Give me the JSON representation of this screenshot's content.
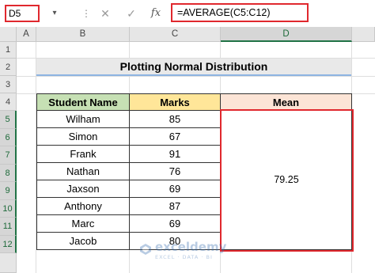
{
  "formula_bar": {
    "name_box": "D5",
    "formula": "=AVERAGE(C5:C12)",
    "cancel_icon": "✕",
    "confirm_icon": "✓",
    "fx_label": "fx"
  },
  "columns": [
    "A",
    "B",
    "C",
    "D"
  ],
  "rows": [
    "1",
    "2",
    "3",
    "4",
    "5",
    "6",
    "7",
    "8",
    "9",
    "10",
    "11",
    "12"
  ],
  "sheet": {
    "title": "Plotting Normal Distribution",
    "headers": {
      "name": "Student Name",
      "marks": "Marks",
      "mean": "Mean"
    },
    "students": [
      {
        "name": "Wilham",
        "marks": "85"
      },
      {
        "name": "Simon",
        "marks": "67"
      },
      {
        "name": "Frank",
        "marks": "91"
      },
      {
        "name": "Nathan",
        "marks": "76"
      },
      {
        "name": "Jaxson",
        "marks": "69"
      },
      {
        "name": "Anthony",
        "marks": "87"
      },
      {
        "name": "Marc",
        "marks": "69"
      },
      {
        "name": "Jacob",
        "marks": "80"
      }
    ],
    "mean_value": "79.25"
  },
  "watermark": {
    "name": "exceldemy",
    "tagline": "EXCEL · DATA · BI"
  },
  "colors": {
    "header_green": "#c6e0b4",
    "header_yellow": "#ffe699",
    "header_peach": "#fce4d6",
    "selection_red": "#e0282e",
    "excel_green": "#217346"
  }
}
